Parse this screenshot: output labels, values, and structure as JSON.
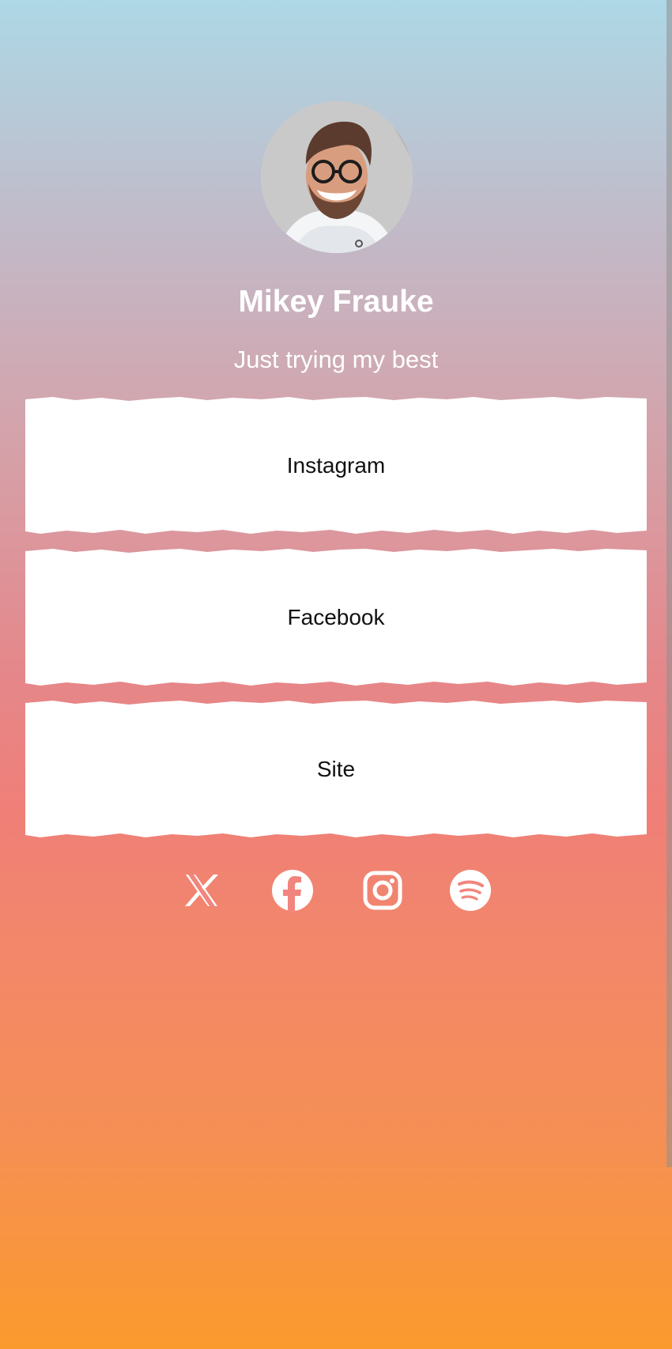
{
  "profile": {
    "name": "Mikey Frauke",
    "bio": "Just trying my best"
  },
  "links": [
    {
      "label": "Instagram"
    },
    {
      "label": "Facebook"
    },
    {
      "label": "Site"
    }
  ],
  "socials": [
    {
      "icon": "x-icon"
    },
    {
      "icon": "facebook-icon"
    },
    {
      "icon": "instagram-icon"
    },
    {
      "icon": "spotify-icon"
    }
  ],
  "colors": {
    "gradient_top": "#add8e6",
    "gradient_middle": "#f07f78",
    "gradient_bottom": "#fb9a2c",
    "card": "#ffffff",
    "text_light": "#ffffff",
    "text_dark": "#111111"
  }
}
